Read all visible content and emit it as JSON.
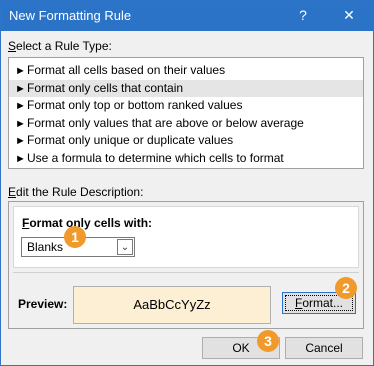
{
  "window": {
    "title": "New Formatting Rule",
    "help_glyph": "?",
    "close_glyph": "✕"
  },
  "rule_type": {
    "label_prefix": "",
    "label_key": "S",
    "label_rest": "elect a Rule Type:",
    "arrow_glyph": "►",
    "items": [
      {
        "label": "Format all cells based on their values",
        "selected": false
      },
      {
        "label": "Format only cells that contain",
        "selected": true
      },
      {
        "label": "Format only top or bottom ranked values",
        "selected": false
      },
      {
        "label": "Format only values that are above or below average",
        "selected": false
      },
      {
        "label": "Format only unique or duplicate values",
        "selected": false
      },
      {
        "label": "Use a formula to determine which cells to format",
        "selected": false
      }
    ]
  },
  "description": {
    "label_key": "E",
    "label_rest": "dit the Rule Description:",
    "heading_key": "F",
    "heading_rest": "ormat only cells with:",
    "condition_value": "Blanks",
    "dropdown_glyph": "⌄",
    "preview_label": "Preview:",
    "preview_sample": "AaBbCcYyZz",
    "format_button_key": "F",
    "format_button_rest": "ormat...",
    "preview_bg": "#fdefd4"
  },
  "buttons": {
    "ok": "OK",
    "cancel": "Cancel"
  },
  "badges": [
    "1",
    "2",
    "3"
  ],
  "colors": {
    "titlebar": "#2b73c7",
    "badge": "#f09a2c",
    "dialog_bg": "#f0f0f0",
    "selected_row": "#e5e5e5"
  }
}
